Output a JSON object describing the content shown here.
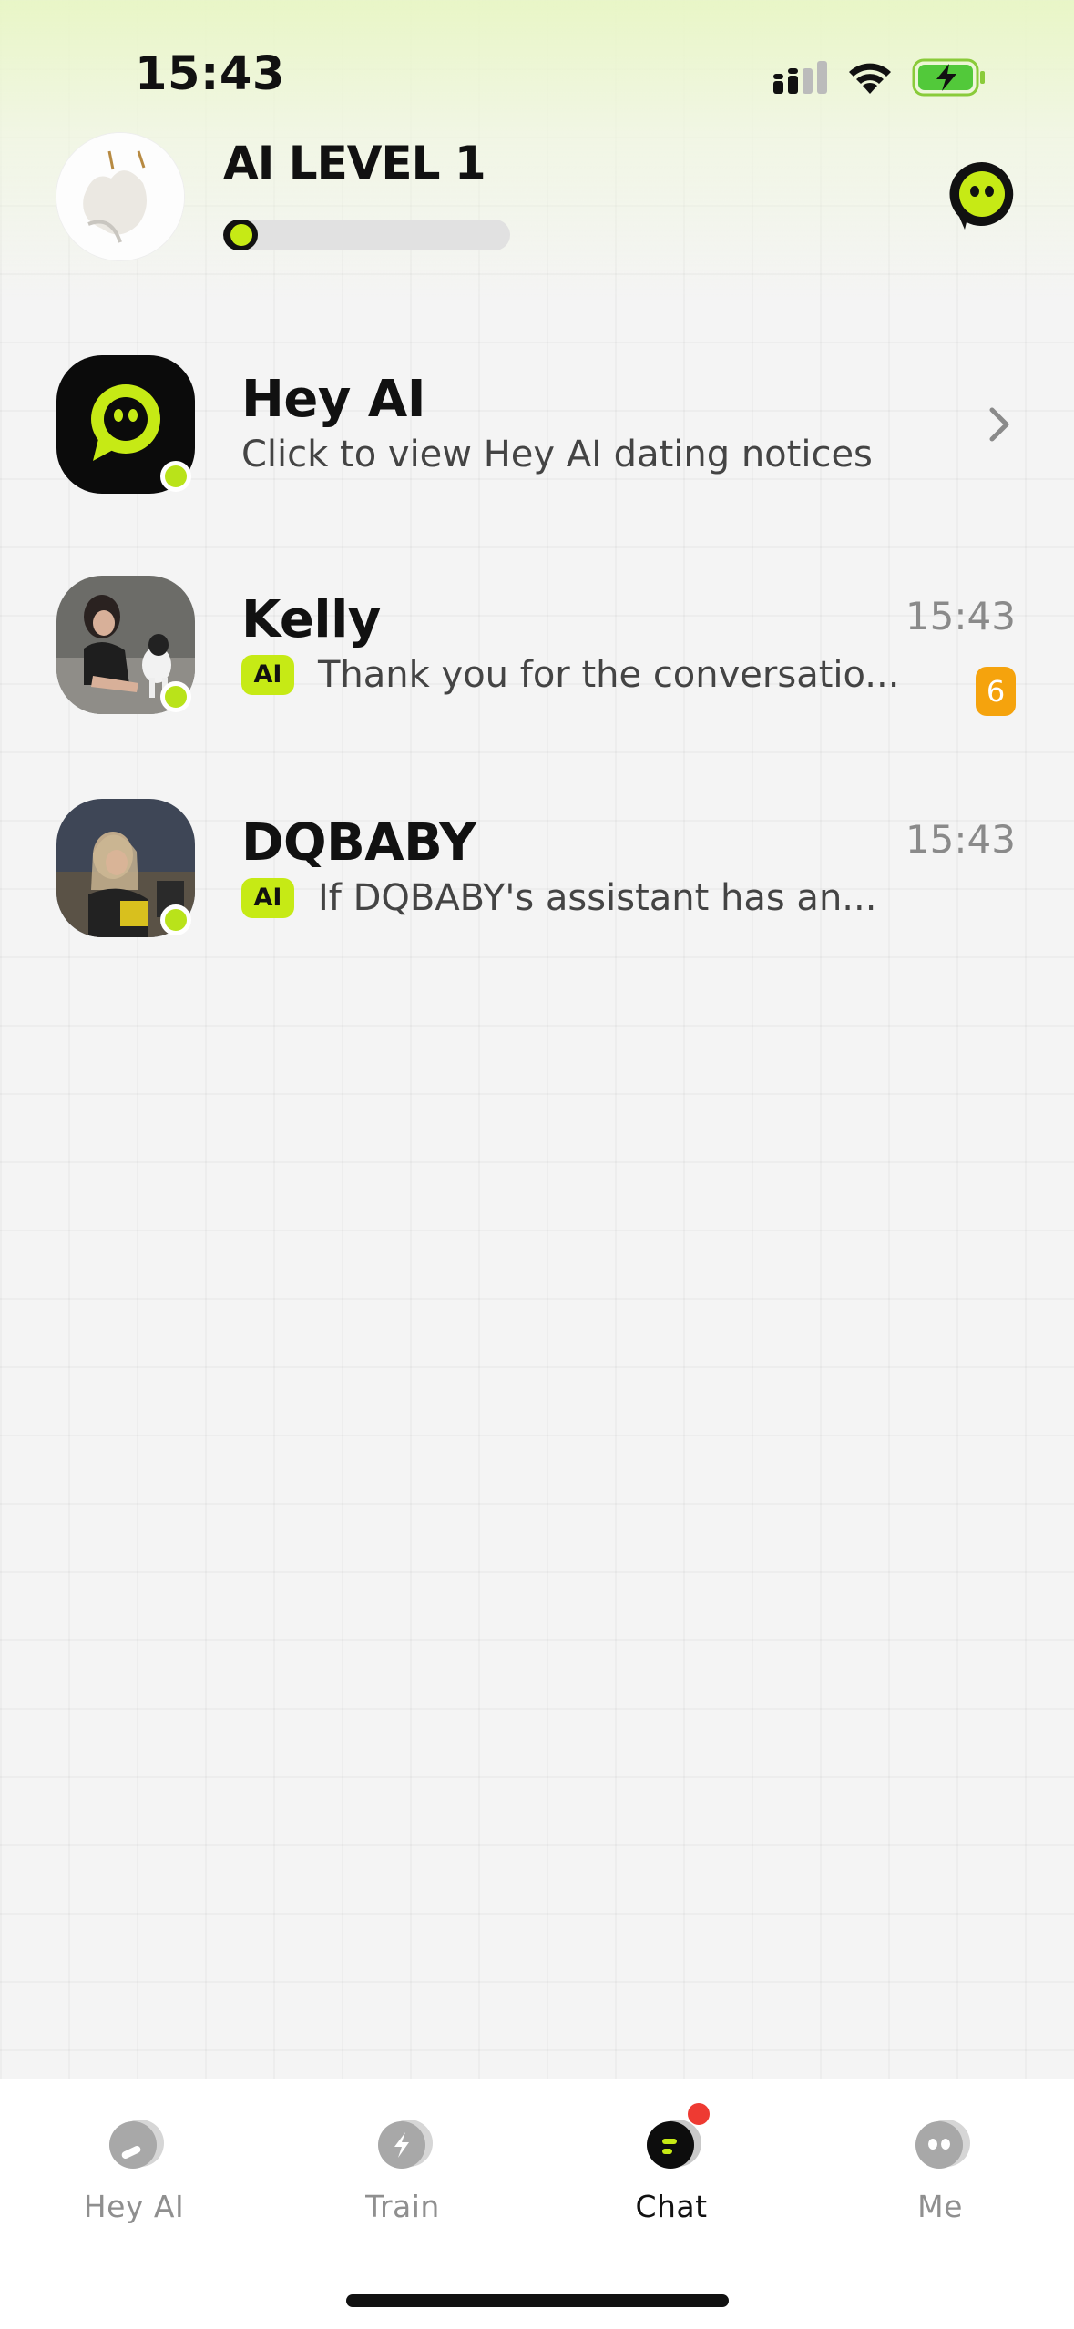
{
  "status_bar": {
    "time": "15:43",
    "icons": [
      "signal-icon",
      "wifi-icon",
      "battery-charging-icon"
    ]
  },
  "header": {
    "level_title": "AI LEVEL 1",
    "level_progress": 0.08,
    "right_icon": "bot-chat-icon"
  },
  "chats": [
    {
      "name": "Hey AI",
      "preview": "Click to view Hey AI dating notices",
      "time": "",
      "ai_badge": "",
      "unread": "",
      "online": true
    },
    {
      "name": "Kelly",
      "preview": "Thank you for the conversatio...",
      "time": "15:43",
      "ai_badge": "AI",
      "unread": "6",
      "online": true
    },
    {
      "name": "DQBABY",
      "preview": "If DQBABY's assistant has an...",
      "time": "15:43",
      "ai_badge": "AI",
      "unread": "",
      "online": true
    }
  ],
  "tabs": [
    {
      "label": "Hey AI",
      "icon": "hey-ai-icon",
      "active": false
    },
    {
      "label": "Train",
      "icon": "train-icon",
      "active": false
    },
    {
      "label": "Chat",
      "icon": "chat-icon",
      "active": true,
      "notification_dot": true
    },
    {
      "label": "Me",
      "icon": "me-icon",
      "active": false
    }
  ],
  "colors": {
    "accent": "#c6ea15",
    "online": "#b9e31a",
    "unread_badge": "#f5a30d",
    "notification_dot": "#ee3a32"
  }
}
